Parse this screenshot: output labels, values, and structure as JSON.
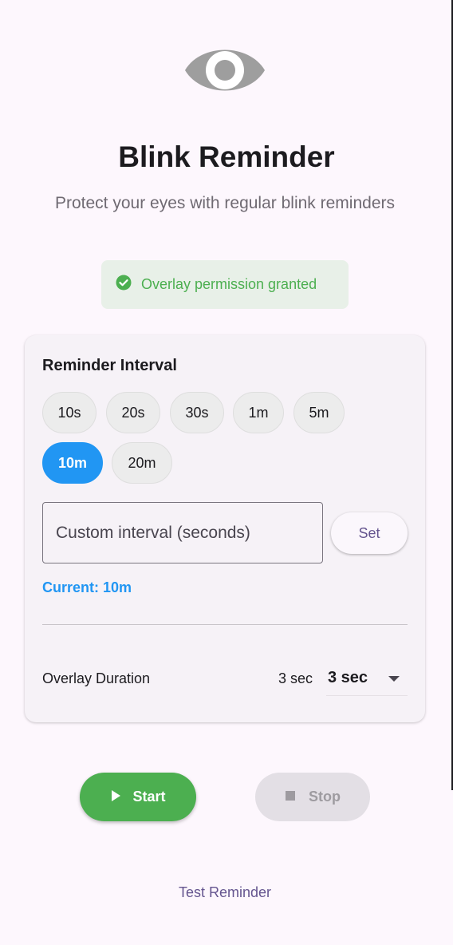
{
  "app": {
    "title": "Blink Reminder",
    "subtitle": "Protect your eyes with regular blink reminders",
    "logo_icon": "eye-icon"
  },
  "permission": {
    "text": "Overlay permission granted",
    "icon": "check-circle-icon",
    "color": "#4caf50"
  },
  "interval": {
    "title": "Reminder Interval",
    "options": [
      "10s",
      "20s",
      "30s",
      "1m",
      "5m",
      "10m",
      "20m"
    ],
    "selected": "10m",
    "accent": "#2196f3",
    "custom_placeholder": "Custom interval (seconds)",
    "set_label": "Set",
    "current_label": "Current: 10m"
  },
  "duration": {
    "label": "Overlay Duration",
    "value": "3 sec",
    "selected_option": "3 sec"
  },
  "controls": {
    "start_label": "Start",
    "stop_label": "Stop",
    "test_label": "Test Reminder"
  }
}
